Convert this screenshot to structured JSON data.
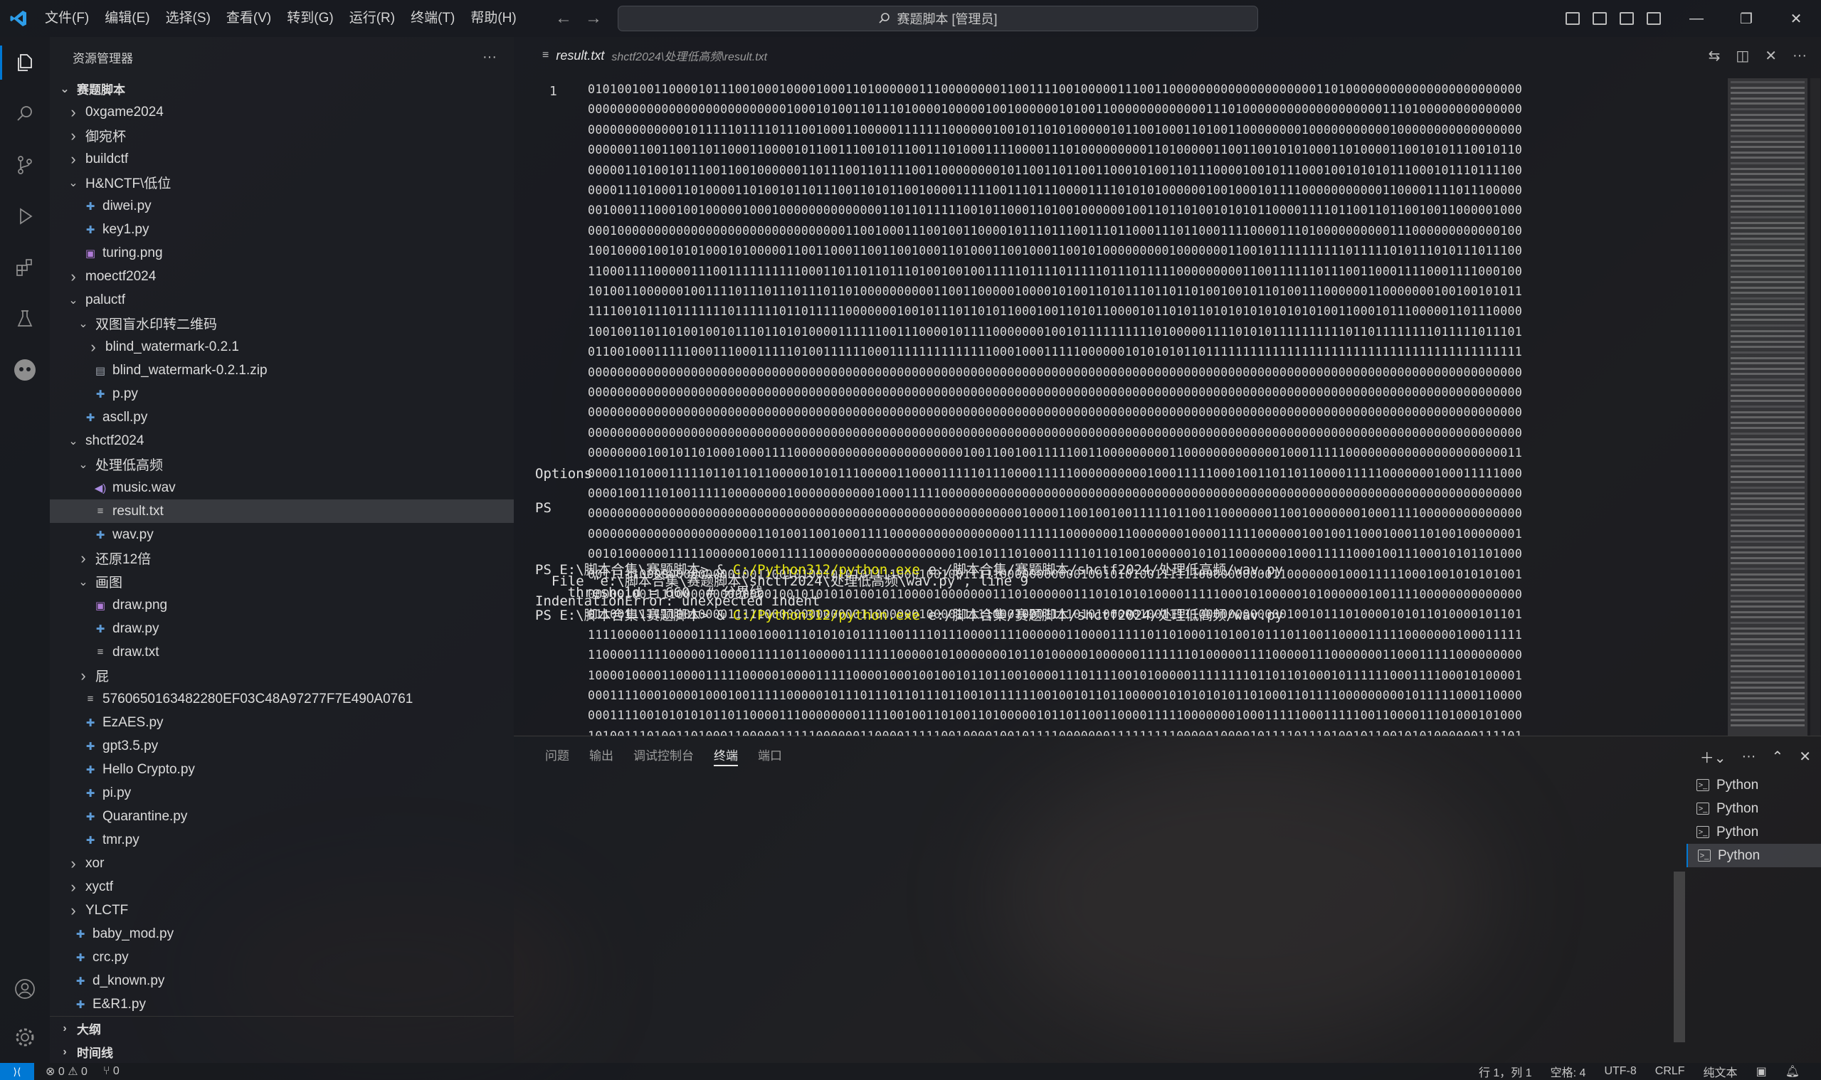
{
  "menu": [
    "文件(F)",
    "编辑(E)",
    "选择(S)",
    "查看(V)",
    "转到(G)",
    "运行(R)",
    "终端(T)",
    "帮助(H)"
  ],
  "command_center": "赛题脚本 [管理员]",
  "sidebar": {
    "title": "资源管理器",
    "more": "···",
    "tree": [
      {
        "label": "赛题脚本",
        "depth": 0,
        "type": "root",
        "chev": "open"
      },
      {
        "label": "0xgame2024",
        "depth": 1,
        "type": "folder",
        "chev": "closed"
      },
      {
        "label": "御宛杯",
        "depth": 1,
        "type": "folder",
        "chev": "closed"
      },
      {
        "label": "buildctf",
        "depth": 1,
        "type": "folder",
        "chev": "closed"
      },
      {
        "label": "H&NCTF\\低位",
        "depth": 1,
        "type": "folder",
        "chev": "open"
      },
      {
        "label": "diwei.py",
        "depth": 2,
        "type": "py"
      },
      {
        "label": "key1.py",
        "depth": 2,
        "type": "py"
      },
      {
        "label": "turing.png",
        "depth": 2,
        "type": "img"
      },
      {
        "label": "moectf2024",
        "depth": 1,
        "type": "folder",
        "chev": "closed"
      },
      {
        "label": "paluctf",
        "depth": 1,
        "type": "folder",
        "chev": "open"
      },
      {
        "label": "双图盲水印转二维码",
        "depth": 2,
        "type": "folder",
        "chev": "open"
      },
      {
        "label": "blind_watermark-0.2.1",
        "depth": 3,
        "type": "folder",
        "chev": "closed"
      },
      {
        "label": "blind_watermark-0.2.1.zip",
        "depth": 3,
        "type": "zip"
      },
      {
        "label": "p.py",
        "depth": 3,
        "type": "py"
      },
      {
        "label": "ascll.py",
        "depth": 2,
        "type": "py"
      },
      {
        "label": "shctf2024",
        "depth": 1,
        "type": "folder",
        "chev": "open"
      },
      {
        "label": "处理低高频",
        "depth": 2,
        "type": "folder",
        "chev": "open"
      },
      {
        "label": "music.wav",
        "depth": 3,
        "type": "wav"
      },
      {
        "label": "result.txt",
        "depth": 3,
        "type": "txt",
        "selected": true
      },
      {
        "label": "wav.py",
        "depth": 3,
        "type": "py"
      },
      {
        "label": "还原12倍",
        "depth": 2,
        "type": "folder",
        "chev": "closed"
      },
      {
        "label": "画图",
        "depth": 2,
        "type": "folder",
        "chev": "open"
      },
      {
        "label": "draw.png",
        "depth": 3,
        "type": "img"
      },
      {
        "label": "draw.py",
        "depth": 3,
        "type": "py"
      },
      {
        "label": "draw.txt",
        "depth": 3,
        "type": "txt"
      },
      {
        "label": "屁",
        "depth": 2,
        "type": "folder",
        "chev": "closed"
      },
      {
        "label": "5760650163482280EF03C48A97277F7E490A0761",
        "depth": 2,
        "type": "txt"
      },
      {
        "label": "EzAES.py",
        "depth": 2,
        "type": "py"
      },
      {
        "label": "gpt3.5.py",
        "depth": 2,
        "type": "py"
      },
      {
        "label": "Hello Crypto.py",
        "depth": 2,
        "type": "py"
      },
      {
        "label": "pi.py",
        "depth": 2,
        "type": "py"
      },
      {
        "label": "Quarantine.py",
        "depth": 2,
        "type": "py"
      },
      {
        "label": "tmr.py",
        "depth": 2,
        "type": "py"
      },
      {
        "label": "xor",
        "depth": 1,
        "type": "folder",
        "chev": "closed"
      },
      {
        "label": "xyctf",
        "depth": 1,
        "type": "folder",
        "chev": "closed"
      },
      {
        "label": "YLCTF",
        "depth": 1,
        "type": "folder",
        "chev": "closed"
      },
      {
        "label": "baby_mod.py",
        "depth": 1,
        "type": "py"
      },
      {
        "label": "crc.py",
        "depth": 1,
        "type": "py"
      },
      {
        "label": "d_known.py",
        "depth": 1,
        "type": "py"
      },
      {
        "label": "E&R1.py",
        "depth": 1,
        "type": "py"
      }
    ],
    "sections": [
      "大纲",
      "时间线"
    ]
  },
  "editor": {
    "tab_name": "result.txt",
    "tab_path": "shctf2024\\处理低高频\\result.txt",
    "line_number": "1",
    "lines": [
      "0101001001100001011100100010000100011010000001110000000011001111001000001110011000000000000000000001101000000000000000000000000",
      "0000000000000000000000000001000101001101110100001000001001000000101001100000000000001110100000000000000000001110100000000000000",
      "0000000000000101111101111011100100011000001111111000000100101101010000010110010001101001100000000100000000000100000000000000000",
      "0000001100110011011000110000101100111001011100111010001111000011101000000000110100000110011001010100011010000110010101110010110",
      "0000011010010111001100100000011011100110111100110000000010110011011001100010100110111000010010111000100101010111000101110111100",
      "0000111010001101000011010010110111001101011001000011111001110111000011110101010000001001000101111000000000001100001111011100000",
      "0010001110001001000001000100000000000000110110111110010110001101001000000100110110100101010110000111101100110110010011000001000",
      "0001000000000000000000000000000000011001000111001001100001011101110011101100011101100011110000111010000000000111000000000000100",
      "1001000010010101000101000001100110001100110010001101000110010001100101000000000100000001100101111111111011111010111010111011100",
      "1100011110000011100111111111100011011011011101001001001111101111011111011101111100000000011001111110111001100011110001111000100",
      "1010011000000100111101110111011101101000000000011001100000100001010011010111011011010010010110100111000000110000000100100101011",
      "1111001011101111111011111101101111100000001001011101101011000100110101100001011010110101010101010101001100010111000001101110000",
      "1001001101101001001011101101010000111111001110000101111000000010010111111111101000001111010101111111111011011111111011111011101",
      "0110010001111100011100011111010011111100011111111111111000100011111000000101010101101111111111111111111111111111111111111111111",
      "0000000000000000000000000000000000000000000000000000000000000000000000000000000000000000000000000000000000000000000000000000000",
      "0000000000000000000000000000000000000000000000000000000000000000000000000000000000000000000000000000000000000000000000000000000",
      "0000000000000000000000000000000000000000000000000000000000000000000000000000000000000000000000000000000000000000000000000000000",
      "0000000000000000000000000000000000000000000000000000000000000000000000000000000000000000000000000000000000000000000000000000000",
      "0000000010010110100010001111000000000000000000000001001100100111110011000000000110000000000000100011111000000000000000000000011",
      "0000110100011111011011011000001010111000001100001111101110000111110000000000100011111000100110110110000111110000000100011111000",
      "0000100111010011111000000001000000000001000111110000000000000000000000000000000000000000000000000000000000000000000000000000000",
      "0000000000000000000000000000000000000000000000000000000000010000110010010011111011001100000001100100000001000111100000000000000",
      "0000000000000000000000011010011001000111100000000000000000111111100000001100000001000011111000000100100110001000110100100000001",
      "0010100000011111000000100011111000000000000000000010010111010001111101101001000000101011000000010001111100010011100010101101000",
      "0011111000000000000010011001010010101011110001001001111100000000000100101010011111100000000001100000001000111110001001010101001",
      "0000010011110000000000000100101010101001011000010000000111010000001110101010100001111100010100000101000000100111100000000000000",
      "0110011111110010000111110000000000000110000001000011111000100011110101000001001111100000000000010010111010000101011010000101101",
      "1111000001100001111100010001110101010111100111101110000111100000011000011111011010001101001011101100110000111110000000100011111",
      "1100001111100000110000111110110000011111110000010100000001011010000010000001111111010000011110000011100000001100011111000000000",
      "1000010000110000111110000010000111110000100010010010110110010000111011110010100000111111110110110100010111111000111100010100001",
      "0001111000100001000100111110000010111011101101110110010111111001001011011000001010101010110100011011110000000001011111000110000",
      "0001111001010101011011000011100000000111100100110100110100000101101100110000111110000000100011111000111110011000011101000101000",
      "1010011101001101000110000011111000000110000111110010000100101111000000011111111100000100001011110111010010110010101000000111101"
    ]
  },
  "panel": {
    "tabs": [
      "问题",
      "输出",
      "调试控制台",
      "终端",
      "端口"
    ],
    "active_tab": "终端",
    "terminal_lines": [
      {
        "text": "Options"
      },
      {
        "text": "PS"
      },
      {
        "prefix": "PS E:\\脚本合集\\赛题脚本> & ",
        "exe": "C:/Python312/python.exe",
        "suffix": " e:/脚本合集/赛题脚本/shctf2024/处理低高频/wav.py"
      },
      {
        "text": "  File \"e:\\脚本合集\\赛题脚本\\shctf2024\\处理低高频\\wav.py\", line 9"
      },
      {
        "text": "    threshold = 660  # 分界线"
      },
      {
        "text": "IndentationError: unexpected indent"
      },
      {
        "prefix": "PS E:\\脚本合集\\赛题脚本> & ",
        "exe": "C:/Python312/python.exe",
        "suffix": " e:/脚本合集/赛题脚本/shctf2024/处理低高频/wav.py"
      }
    ],
    "terminals": [
      "Python",
      "Python",
      "Python",
      "Python"
    ]
  },
  "status": {
    "errors": "⊗ 0 ⚠ 0",
    "ports": "⑂ 0",
    "position": "行 1，列 1",
    "spaces": "空格: 4",
    "encoding": "UTF-8",
    "eol": "CRLF",
    "language": "纯文本"
  },
  "colors": {
    "accent": "#0078d4",
    "terminal_exe": "#e5e510",
    "python_icon": "#5e9bd6"
  }
}
